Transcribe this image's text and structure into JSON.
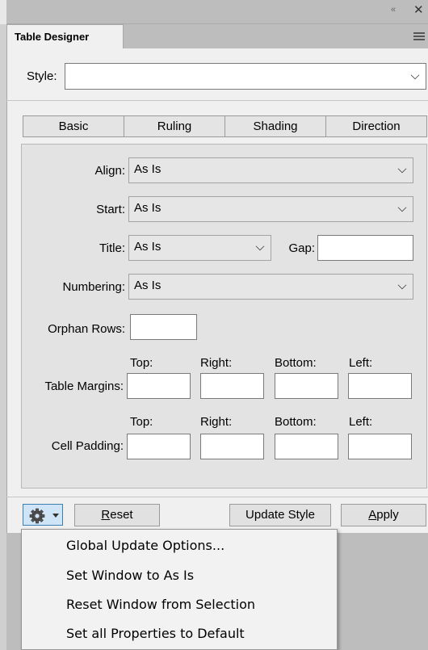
{
  "window": {
    "tab_title": "Table Designer",
    "collapse_glyph": "«",
    "close_glyph": "✕"
  },
  "style": {
    "label": "Style:",
    "value": ""
  },
  "tabs": [
    "Basic",
    "Ruling",
    "Shading",
    "Direction"
  ],
  "basic": {
    "align": {
      "label": "Align:",
      "value": "As Is"
    },
    "start": {
      "label": "Start:",
      "value": "As Is"
    },
    "title": {
      "label": "Title:",
      "value": "As Is"
    },
    "gap": {
      "label": "Gap:",
      "value": ""
    },
    "numbering": {
      "label": "Numbering:",
      "value": "As Is"
    },
    "orphan_rows": {
      "label": "Orphan Rows:",
      "value": ""
    },
    "table_margins": {
      "label": "Table Margins:",
      "headers": [
        "Top:",
        "Right:",
        "Bottom:",
        "Left:"
      ],
      "values": [
        "",
        "",
        "",
        ""
      ]
    },
    "cell_padding": {
      "label": "Cell Padding:",
      "headers": [
        "Top:",
        "Right:",
        "Bottom:",
        "Left:"
      ],
      "values": [
        "",
        "",
        "",
        ""
      ]
    }
  },
  "buttons": {
    "reset_pre": "",
    "reset_ul": "R",
    "reset_post": "eset",
    "update_style": "Update Style",
    "apply_pre": "",
    "apply_ul": "A",
    "apply_post": "pply"
  },
  "menu": {
    "items": [
      "Global Update Options...",
      "Set Window to As Is",
      "Reset Window from Selection",
      "Set all Properties to Default"
    ]
  },
  "icons": {
    "gear": "gear-icon",
    "panel_menu": "panel-menu-icon"
  }
}
